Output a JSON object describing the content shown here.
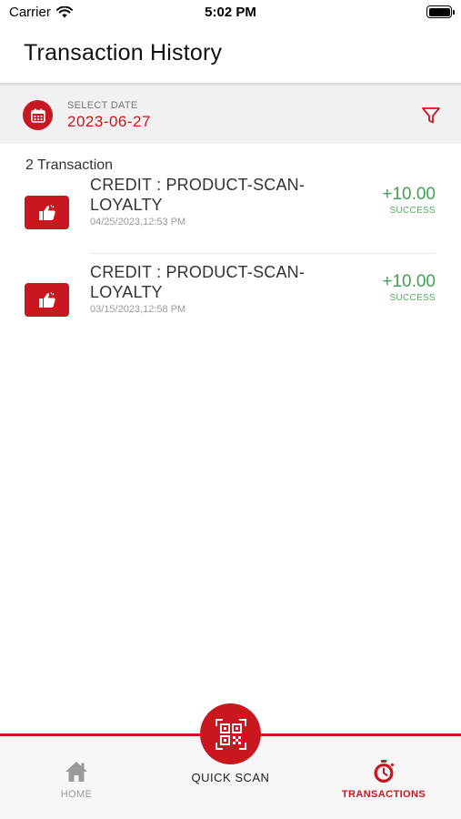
{
  "status_bar": {
    "carrier": "Carrier",
    "time": "5:02 PM"
  },
  "header": {
    "title": "Transaction History"
  },
  "date_filter": {
    "caption": "SELECT DATE",
    "value": "2023-06-27"
  },
  "summary": {
    "count_text": "2 Transaction"
  },
  "transactions": [
    {
      "title": "CREDIT : PRODUCT-SCAN-LOYALTY",
      "datetime": "04/25/2023,12:53 PM",
      "amount": "+10.00",
      "status": "SUCCESS"
    },
    {
      "title": "CREDIT : PRODUCT-SCAN-LOYALTY",
      "datetime": "03/15/2023,12:58 PM",
      "amount": "+10.00",
      "status": "SUCCESS"
    }
  ],
  "tabbar": {
    "home": {
      "label": "HOME",
      "icon": "home-icon"
    },
    "scan": {
      "label": "QUICK SCAN",
      "icon": "qr-code-icon"
    },
    "transactions": {
      "label": "TRANSACTIONS",
      "icon": "stopwatch-icon"
    }
  },
  "colors": {
    "brand": "#c8171e",
    "success": "#3fa34d",
    "muted": "#9a9a9a"
  }
}
